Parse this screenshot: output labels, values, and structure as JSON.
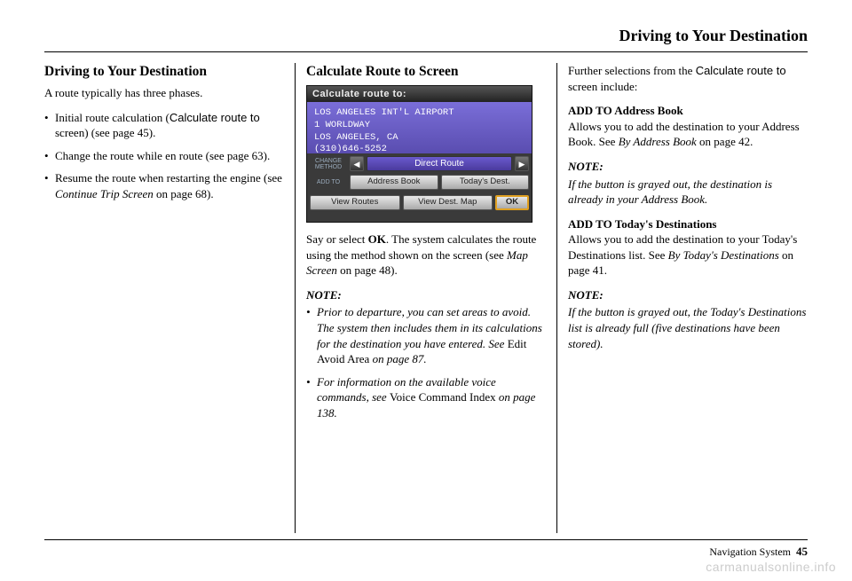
{
  "header": {
    "title": "Driving to Your Destination"
  },
  "col1": {
    "heading": "Driving to Your Destination",
    "intro": "A route typically has three phases.",
    "bullets": {
      "b1_a": "Initial route calculation (",
      "b1_b": "Calculate route to",
      "b1_c": " screen) (see page 45).",
      "b2": "Change the route while en route (see page 63).",
      "b3_a": "Resume the route when restarting the engine (see ",
      "b3_b": "Continue Trip Screen",
      "b3_c": " on page 68)."
    }
  },
  "col2": {
    "heading": "Calculate Route to Screen",
    "screenshot": {
      "title": "Calculate route to:",
      "line1": "LOS ANGELES INT'L AIRPORT",
      "line2": "1 WORLDWAY",
      "line3": "LOS ANGELES, CA",
      "line4": "(310)646-5252",
      "change_label": "CHANGE METHOD",
      "direct": "Direct Route",
      "addto_label": "ADD TO",
      "addr_book": "Address Book",
      "todays": "Today's Dest.",
      "view_routes": "View Routes",
      "view_dest": "View Dest. Map",
      "ok": "OK"
    },
    "p1_a": "Say or select ",
    "p1_b": "OK",
    "p1_c": ". The system calculates the route using the method shown on the screen (see ",
    "p1_d": "Map Screen",
    "p1_e": " on page 48).",
    "note_label": "NOTE:",
    "note_bullets": {
      "n1_a": "Prior to departure, you can set areas to avoid. The system then includes them in its calculations for the destination you have entered. See ",
      "n1_b": "Edit Avoid Area",
      "n1_c": " on page 87.",
      "n2_a": "For information on the available voice commands, see ",
      "n2_b": "Voice Command Index",
      "n2_c": " on page 138."
    }
  },
  "col3": {
    "intro_a": "Further selections from the ",
    "intro_b": "Calculate route to",
    "intro_c": " screen include:",
    "h1": "ADD TO Address Book",
    "p1_a": "Allows you to add the destination to your Address Book. See ",
    "p1_b": "By Address Book",
    "p1_c": " on page 42.",
    "note_label1": "NOTE:",
    "note1": "If the button is grayed out, the destination is already in your Address Book.",
    "h2": "ADD TO Today's Destinations",
    "p2_a": "Allows you to add the destination to your Today's Destinations list. See ",
    "p2_b": "By Today's Destinations",
    "p2_c": " on page 41.",
    "note_label2": "NOTE:",
    "note2": "If the button is grayed out, the Today's Destinations list is already full (five destinations have been stored)."
  },
  "footer": {
    "label": "Navigation System",
    "page": "45"
  },
  "watermark": "carmanualsonline.info"
}
